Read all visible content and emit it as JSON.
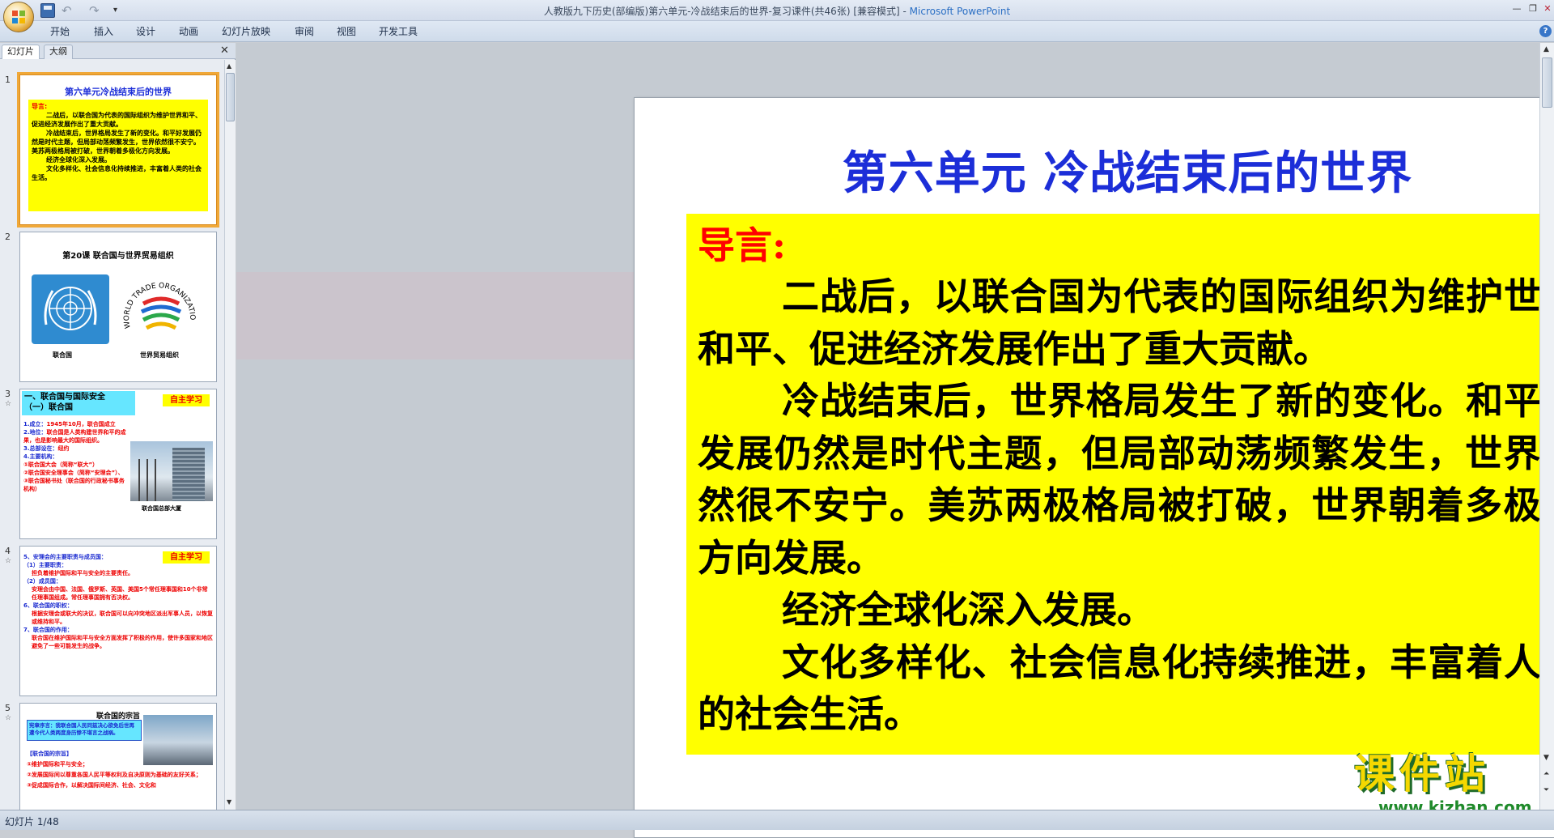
{
  "window": {
    "title": "人教版九下历史(部编版)第六单元-冷战结束后的世界-复习课件(共46张) [兼容模式]",
    "app_sep": " - ",
    "app_name": "Microsoft PowerPoint"
  },
  "quick_access": {
    "undo": "↶",
    "redo": "↷",
    "more": "▾"
  },
  "ribbon": {
    "tabs": [
      "开始",
      "插入",
      "设计",
      "动画",
      "幻灯片放映",
      "审阅",
      "视图",
      "开发工具"
    ],
    "help": "?"
  },
  "left_pane": {
    "tabs": [
      "幻灯片",
      "大纲"
    ],
    "close": "✕",
    "slide_numbers": [
      "1",
      "2",
      "3",
      "4",
      "5"
    ],
    "star": "☆",
    "thumb1": {
      "title": "第六单元冷战结束后的世界",
      "label": "导言:",
      "lines": [
        "二战后，以联合国为代表的国际组织为维护世界和平、促进经济发展作出了重大贡献。",
        "冷战结束后，世界格局发生了新的变化。和平好发展仍然是时代主题，但局部动荡频繁发生，世界依然很不安宁。美苏两极格局被打破，世界朝着多极化方向发展。",
        "经济全球化深入发展。",
        "文化多样化、社会信息化持续推进，丰富着人类的社会生活。"
      ]
    },
    "thumb2": {
      "title": "第20课  联合国与世界贸易组织",
      "wto_text": "WORLD TRADE ORGANIZATION",
      "caption_un": "联合国",
      "caption_wto": "世界贸易组织"
    },
    "thumb3": {
      "heading1": "一、联合国与国际安全",
      "heading2": "（一）联合国",
      "tag": "自主学习",
      "l1a": "1.成立：",
      "l1b": "1945年10月，联合国成立",
      "l2a": "2.地位：",
      "l2b": "联合国是人类构建世界和平的成果，也是影响最大的国际组织。",
      "l3a": "3.总部设在：",
      "l3b": "纽约",
      "l4": "4.主要机构：",
      "l5": "①联合国大会（简称“联大”）",
      "l6": "②联合国安全理事会（简称“安理会”）、",
      "l7": "③联合国秘书处（联合国的行政秘书事务机构）",
      "caption": "联合国总部大厦"
    },
    "thumb4": {
      "tag": "自主学习",
      "a": "5、安理会的主要职责与成员国：",
      "b": "（1）主要职责：",
      "c": "担负着维护国际和平与安全的主要责任。",
      "d": "（2）成员国：",
      "e": "安理会由中国、法国、俄罗斯、英国、美国5个常任理事国和10个非常任理事国组成。常任理事国拥有否决权。",
      "f": "6、联合国的职权：",
      "g": "根据安理会或联大的决议，联合国可以向冲突地区派出军事人员，以恢复或维持和平。",
      "h": "7、联合国的作用：",
      "i": "联合国在维护国际和平与安全方面发挥了积极的作用，使许多国家和地区避免了一些可能发生的战争。"
    },
    "thumb5": {
      "title": "联合国的宗旨",
      "box": "宪章序言：我联合国人民同兹决心欲免后世再遭今代人类两度身历惨不堪言之战祸。",
      "heading": "【联合国的宗旨】",
      "l1": "①维护国际和平与安全；",
      "l2": "②发展国际间以尊重各国人民平等权利及自决原则为基础的友好关系；",
      "l3": "③促成国际合作，以解决国际间经济、社会、文化和"
    }
  },
  "slide": {
    "title": "第六单元 冷战结束后的世界",
    "intro_label": "导言:",
    "paragraphs": [
      "二战后，以联合国为代表的国际组织为维护世界和平、促进经济发展作出了重大贡献。",
      "冷战结束后，世界格局发生了新的变化。和平好发展仍然是时代主题，但局部动荡频繁发生，世界依然很不安宁。美苏两极格局被打破，世界朝着多极化方向发展。",
      "经济全球化深入发展。",
      "文化多样化、社会信息化持续推进，丰富着人类的社会生活。"
    ]
  },
  "watermark": {
    "cn": "课件站",
    "url": "www.kjzhan.com"
  },
  "status": {
    "slide_pos": "幻灯片 1/48"
  },
  "colors": {
    "title_blue": "#1c2ed8",
    "highlight_yellow": "#ffff00",
    "label_red": "#ff0000",
    "selection_orange": "#f0a838"
  }
}
